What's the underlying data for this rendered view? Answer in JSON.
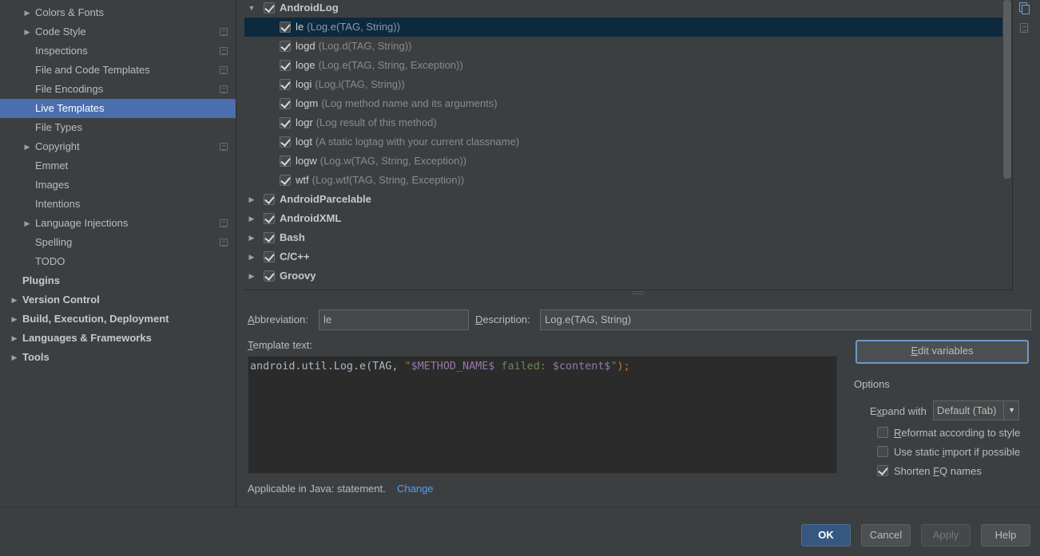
{
  "sidebar": {
    "items": [
      {
        "label": "Colors & Fonts",
        "expandable": true,
        "project_icon": false,
        "bold": false
      },
      {
        "label": "Code Style",
        "expandable": true,
        "project_icon": true,
        "bold": false
      },
      {
        "label": "Inspections",
        "expandable": false,
        "project_icon": true,
        "bold": false
      },
      {
        "label": "File and Code Templates",
        "expandable": false,
        "project_icon": true,
        "bold": false
      },
      {
        "label": "File Encodings",
        "expandable": false,
        "project_icon": true,
        "bold": false
      },
      {
        "label": "Live Templates",
        "expandable": false,
        "project_icon": false,
        "bold": false,
        "selected": true
      },
      {
        "label": "File Types",
        "expandable": false,
        "project_icon": false,
        "bold": false
      },
      {
        "label": "Copyright",
        "expandable": true,
        "project_icon": true,
        "bold": false
      },
      {
        "label": "Emmet",
        "expandable": false,
        "project_icon": false,
        "bold": false
      },
      {
        "label": "Images",
        "expandable": false,
        "project_icon": false,
        "bold": false
      },
      {
        "label": "Intentions",
        "expandable": false,
        "project_icon": false,
        "bold": false
      },
      {
        "label": "Language Injections",
        "expandable": true,
        "project_icon": true,
        "bold": false
      },
      {
        "label": "Spelling",
        "expandable": false,
        "project_icon": true,
        "bold": false
      },
      {
        "label": "TODO",
        "expandable": false,
        "project_icon": false,
        "bold": false
      },
      {
        "label": "Plugins",
        "expandable": false,
        "project_icon": false,
        "bold": true
      },
      {
        "label": "Version Control",
        "expandable": true,
        "project_icon": false,
        "bold": true
      },
      {
        "label": "Build, Execution, Deployment",
        "expandable": true,
        "project_icon": false,
        "bold": true
      },
      {
        "label": "Languages & Frameworks",
        "expandable": true,
        "project_icon": false,
        "bold": true
      },
      {
        "label": "Tools",
        "expandable": true,
        "project_icon": false,
        "bold": true
      }
    ]
  },
  "templates": {
    "group_open": {
      "label": "AndroidLog",
      "checked": true
    },
    "items": [
      {
        "abbr": "le",
        "desc": "(Log.e(TAG, String))",
        "checked": true,
        "selected": true
      },
      {
        "abbr": "logd",
        "desc": "(Log.d(TAG, String))",
        "checked": true
      },
      {
        "abbr": "loge",
        "desc": "(Log.e(TAG, String, Exception))",
        "checked": true
      },
      {
        "abbr": "logi",
        "desc": "(Log.i(TAG, String))",
        "checked": true
      },
      {
        "abbr": "logm",
        "desc": "(Log method name and its arguments)",
        "checked": true
      },
      {
        "abbr": "logr",
        "desc": "(Log result of this method)",
        "checked": true
      },
      {
        "abbr": "logt",
        "desc": "(A static logtag with your current classname)",
        "checked": true
      },
      {
        "abbr": "logw",
        "desc": "(Log.w(TAG, String, Exception))",
        "checked": true
      },
      {
        "abbr": "wtf",
        "desc": "(Log.wtf(TAG, String, Exception))",
        "checked": true
      }
    ],
    "groups_collapsed": [
      {
        "label": "AndroidParcelable",
        "checked": true
      },
      {
        "label": "AndroidXML",
        "checked": true
      },
      {
        "label": "Bash",
        "checked": true
      },
      {
        "label": "C/C++",
        "checked": true
      },
      {
        "label": "Groovy",
        "checked": true
      }
    ]
  },
  "editor": {
    "abbreviation_label_pre": "",
    "abbreviation_label_u": "A",
    "abbreviation_label_post": "bbreviation:",
    "abbreviation_value": "le",
    "description_label_pre": "",
    "description_label_u": "D",
    "description_label_post": "escription:",
    "description_value": "Log.e(TAG, String)",
    "template_text_label_pre": "",
    "template_text_label_u": "T",
    "template_text_label_post": "emplate text:",
    "code": {
      "p1": "android.util.Log.e(TAG, ",
      "p2": "\"",
      "p3": "$METHOD_NAME$",
      "p4": " failed: ",
      "p5": "$content$",
      "p6": "\"",
      "p7": ");"
    },
    "applicable_text": "Applicable in Java: statement.",
    "change_link": "Change"
  },
  "edit_variables_button": {
    "pre": "",
    "u": "E",
    "post": "dit variables"
  },
  "options": {
    "title": "Options",
    "expand_label_pre": "E",
    "expand_label_u": "x",
    "expand_label_post": "pand with",
    "expand_value": "Default (Tab)",
    "checkboxes": [
      {
        "pre": "",
        "u": "R",
        "post": "eformat according to style",
        "checked": false
      },
      {
        "pre": "Use static ",
        "u": "i",
        "post": "mport if possible",
        "checked": false
      },
      {
        "pre": "Shorten ",
        "u": "F",
        "post": "Q names",
        "checked": true
      }
    ]
  },
  "footer": {
    "ok": "OK",
    "cancel": "Cancel",
    "apply": "Apply",
    "help": "Help"
  }
}
